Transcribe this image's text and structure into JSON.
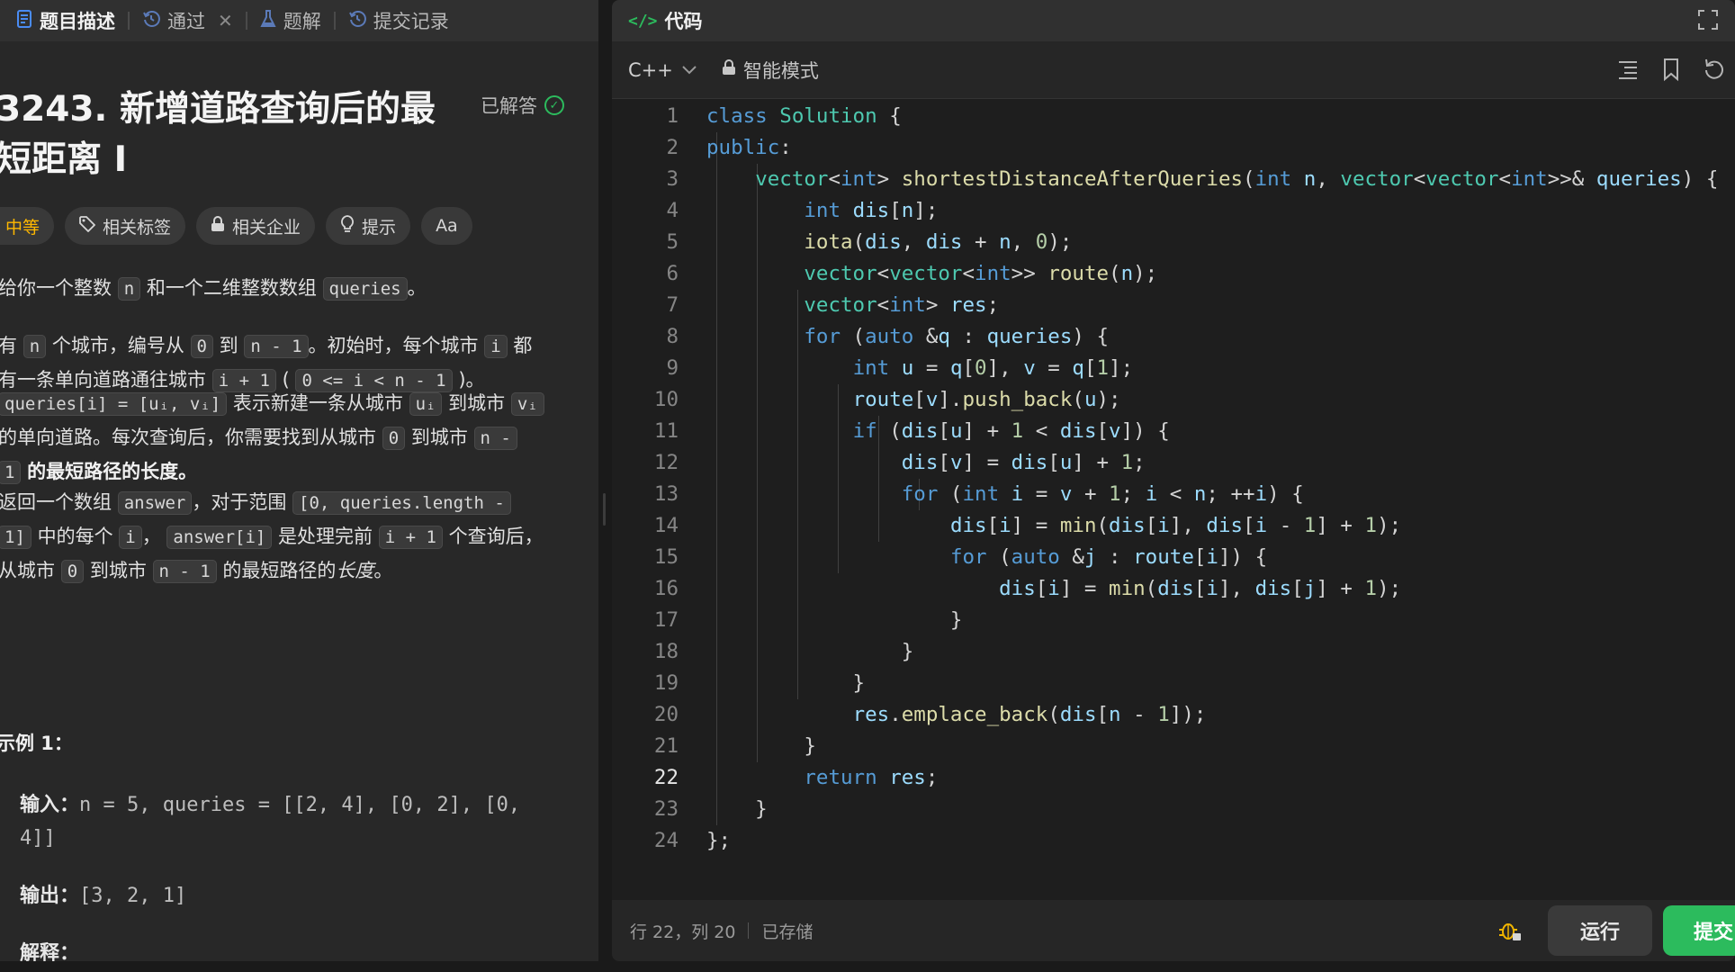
{
  "left_tabs": [
    {
      "label": "题目描述",
      "icon": "document-icon"
    },
    {
      "label": "通过",
      "icon": "history-icon"
    },
    {
      "label": "题解",
      "icon": "flask-icon"
    },
    {
      "label": "提交记录",
      "icon": "history-icon"
    }
  ],
  "problem": {
    "title_line1": "3243. 新增道路查询后的最",
    "title_line2": "短距离 I",
    "solved_label": "已解答",
    "difficulty": "中等",
    "tags": [
      "相关标签",
      "相关企业",
      "提示",
      "Aa"
    ],
    "p1": {
      "a": "给你一个整数",
      "n": "n",
      "b": "和一个二维整数数组",
      "queries": "queries",
      "c": "。"
    },
    "p2": {
      "a": "有",
      "n": "n",
      "b": "个城市，编号从",
      "zero": "0",
      "c": "到",
      "nm1": "n - 1",
      "d": "。初始时，每个城市",
      "i": "i",
      "e": "都",
      "f": "有一条单向道路通往城市",
      "ip1": "i + 1",
      "g": "(",
      "cond": "0 <= i < n - 1",
      "h": ")。"
    },
    "p3": {
      "qi": "queries[i] = [uᵢ, vᵢ]",
      "a": "表示新建一条从城市",
      "ui": "uᵢ",
      "b": "到城市",
      "vi": "vᵢ",
      "c": "的单向道路。每次查询后，你需要找到从城市",
      "zero": "0",
      "d": "到城市",
      "nm": "n -",
      "e": "1",
      "f": "的最短路径的长度。"
    },
    "p4": {
      "a": "返回一个数组",
      "answer": "answer",
      "b": "，对于范围",
      "range": "[0, queries.length -",
      "c": "1]",
      "d": "中的每个",
      "i": "i",
      "e": "，",
      "ai": "answer[i]",
      "f": "是处理完前",
      "ip1": "i + 1",
      "g": "个查询后，",
      "h": "从城市",
      "zero": "0",
      "j": "到城市",
      "nm1": "n - 1",
      "k": "的最短路径的",
      "len": "长度",
      "end": "。"
    },
    "example_title": "示例 1：",
    "input_label": "输入：",
    "input_l1": "n = 5, queries = [[2, 4], [0, 2], [0,",
    "input_l2": "4]]",
    "output_label": "输出：",
    "output_value": "[3, 2, 1]",
    "explain_label": "解释："
  },
  "editor": {
    "title": "代码",
    "language": "C++",
    "mode": "智能模式",
    "cursor_line": 22,
    "status_position": "行 22，列 20",
    "status_saved": "已存储",
    "run_label": "运行",
    "submit_label": "提交"
  }
}
